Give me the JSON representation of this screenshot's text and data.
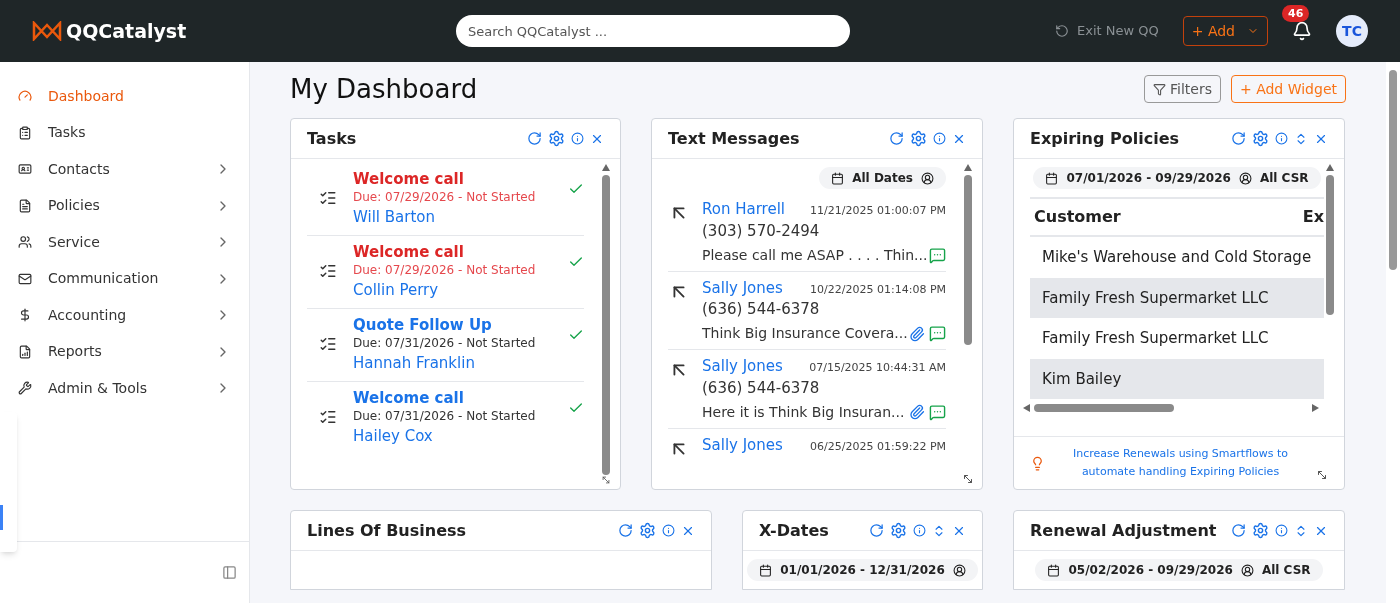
{
  "header": {
    "logo": "QQCatalyst",
    "search": {
      "placeholder": "Search QQCatalyst ..."
    },
    "exit_link": "Exit New QQ",
    "add_button": "+ Add",
    "notifications": "46",
    "avatar": "TC"
  },
  "sidebar": {
    "items": [
      {
        "label": "Dashboard",
        "selected": true,
        "expandable": false
      },
      {
        "label": "Tasks",
        "selected": false,
        "expandable": false
      },
      {
        "label": "Contacts",
        "selected": false,
        "expandable": true
      },
      {
        "label": "Policies",
        "selected": false,
        "expandable": true
      },
      {
        "label": "Service",
        "selected": false,
        "expandable": true
      },
      {
        "label": "Communication",
        "selected": false,
        "expandable": true
      },
      {
        "label": "Accounting",
        "selected": false,
        "expandable": true
      },
      {
        "label": "Reports",
        "selected": false,
        "expandable": true
      },
      {
        "label": "Admin & Tools",
        "selected": false,
        "expandable": true
      }
    ]
  },
  "page": {
    "title": "My Dashboard",
    "filters_button": "Filters",
    "add_widget_button": "+ Add Widget"
  },
  "widgets": [
    {
      "kind": "tasks",
      "title": "Tasks",
      "collapsible": false,
      "items": [
        {
          "title": "Welcome call",
          "due": "Due: 07/29/2026 - Not Started",
          "overdue": true,
          "contact": "Will Barton"
        },
        {
          "title": "Welcome call",
          "due": "Due: 07/29/2026 - Not Started",
          "overdue": true,
          "contact": "Collin Perry"
        },
        {
          "title": "Quote Follow Up",
          "due": "Due: 07/31/2026 - Not Started",
          "overdue": false,
          "contact": "Hannah Franklin"
        },
        {
          "title": "Welcome call",
          "due": "Due: 07/31/2026 - Not Started",
          "overdue": false,
          "contact": "Hailey Cox"
        }
      ]
    },
    {
      "kind": "messages",
      "title": "Text Messages",
      "collapsible": false,
      "filter": {
        "dates": "All Dates"
      },
      "items": [
        {
          "name": "Ron Harrell",
          "time": "11/21/2025 01:00:07 PM",
          "phone": "(303) 570-2494",
          "preview": "Please call me ASAP . . . . Thin...",
          "attachment": false
        },
        {
          "name": "Sally Jones",
          "time": "10/22/2025 01:14:08 PM",
          "phone": "(636) 544-6378",
          "preview": "Think Big Insurance Covera...",
          "attachment": true
        },
        {
          "name": "Sally Jones",
          "time": "07/15/2025 10:44:31 AM",
          "phone": "(636) 544-6378",
          "preview": "Here it is Think Big Insuran...",
          "attachment": true
        },
        {
          "name": "Sally Jones",
          "time": "06/25/2025 01:59:22 PM"
        }
      ]
    },
    {
      "kind": "table",
      "title": "Expiring Policies",
      "collapsible": true,
      "filter": {
        "dates": "07/01/2026 - 09/29/2026",
        "csr": "All CSR"
      },
      "columns": [
        "Customer",
        "Ex"
      ],
      "rows": [
        "Mike's Warehouse and Cold Storage",
        "Family Fresh Supermarket LLC",
        "Family Fresh Supermarket LLC",
        "Kim Bailey"
      ],
      "tip": "Increase Renewals using Smartflows to automate handling Expiring Policies"
    },
    {
      "kind": "empty",
      "title": "Lines Of Business",
      "collapsible": false
    },
    {
      "kind": "chip",
      "title": "X-Dates",
      "collapsible": true,
      "filter": {
        "dates": "01/01/2026 - 12/31/2026"
      }
    },
    {
      "kind": "chip",
      "title": "Renewal Adjustment",
      "collapsible": true,
      "filter": {
        "dates": "05/02/2026 - 09/29/2026",
        "csr": "All CSR"
      }
    }
  ]
}
